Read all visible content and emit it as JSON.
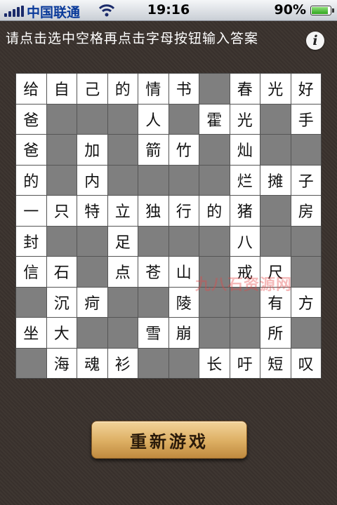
{
  "status_bar": {
    "carrier": "中国联通",
    "time": "19:16",
    "battery_percent": "90%",
    "battery_level": 0.9
  },
  "instruction": "请点击选中空格再点击字母按钮输入答案",
  "info_button": "i",
  "grid": [
    [
      "给",
      "自",
      "己",
      "的",
      "情",
      "书",
      "#",
      "春",
      "光",
      "好"
    ],
    [
      "爸",
      "#",
      "#",
      "#",
      "人",
      "#",
      "霍",
      "光",
      "#",
      "手"
    ],
    [
      "爸",
      "#",
      "加",
      "#",
      "箭",
      "竹",
      "#",
      "灿",
      "#",
      "#"
    ],
    [
      "的",
      "#",
      "内",
      "#",
      "#",
      "#",
      "#",
      "烂",
      "摊",
      "子"
    ],
    [
      "一",
      "只",
      "特",
      "立",
      "独",
      "行",
      "的",
      "猪",
      "#",
      "房"
    ],
    [
      "封",
      "#",
      "#",
      "足",
      "#",
      "#",
      "#",
      "八",
      "#",
      "#"
    ],
    [
      "信",
      "石",
      "#",
      "点",
      "苍",
      "山",
      "#",
      "戒",
      "尺",
      "#"
    ],
    [
      "#",
      "沉",
      "疴",
      "#",
      "#",
      "陵",
      "#",
      "#",
      "有",
      "方"
    ],
    [
      "坐",
      "大",
      "#",
      "#",
      "雪",
      "崩",
      "#",
      "#",
      "所",
      "#"
    ],
    [
      "#",
      "海",
      "魂",
      "衫",
      "#",
      "#",
      "长",
      "吁",
      "短",
      "叹"
    ]
  ],
  "watermark": "九八石资源网",
  "restart_button": "重新游戏"
}
